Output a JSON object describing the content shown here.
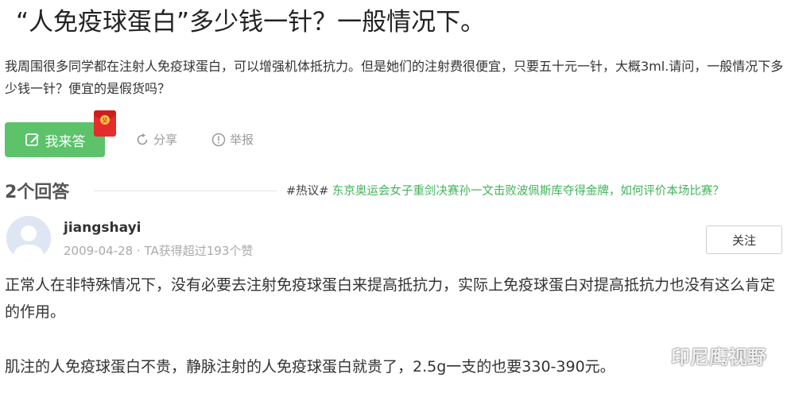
{
  "question": {
    "title": "“人免疫球蛋白”多少钱一针？一般情况下。",
    "body": "我周围很多同学都在注射人免疫球蛋白，可以增强机体抵抗力。但是她们的注射费很便宜，只要五十元一针，大概3ml.请问，一般情况下多少钱一针？便宜的是假货吗？"
  },
  "actions": {
    "answer_label": "我来答",
    "share_label": "分享",
    "report_label": "举报"
  },
  "answers_header": {
    "count_label": "2个回答",
    "hot_tag": "#热议#",
    "hot_topic": "东京奥运会女子重剑决赛孙一文击败波佩斯库夺得金牌，如何评价本场比赛？"
  },
  "answer": {
    "username": "jiangshayi",
    "meta": "2009-04-28 · TA获得超过193个赞",
    "follow_label": "关注",
    "paragraphs": [
      "正常人在非特殊情况下，没有必要去注射免疫球蛋白来提高抵抗力，实际上免疫球蛋白对提高抵抗力也没有这么肯定的作用。",
      "肌注的人免疫球蛋白不贵，静脉注射的人免疫球蛋白就贵了，2.5g一支的也要330-390元。"
    ]
  },
  "watermark": {
    "text": "印尼鹰视野"
  },
  "colors": {
    "accent_green": "#5cc36b",
    "link_green": "#40b45a",
    "muted_gray": "#9a9a9a",
    "redpacket_red": "#e52c2c"
  },
  "icons": {
    "answer": "edit-icon",
    "redpacket": "red-envelope-icon",
    "share": "share-icon",
    "report": "report-icon",
    "avatar": "default-avatar-icon",
    "watermark": "wechat-icon"
  }
}
